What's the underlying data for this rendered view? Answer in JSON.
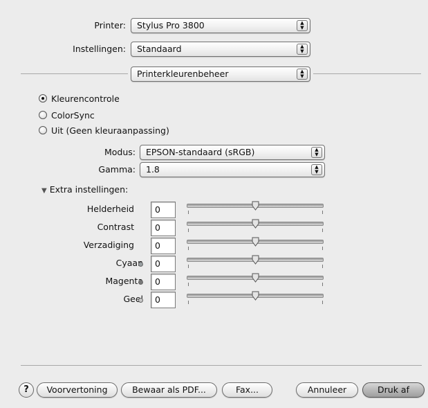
{
  "printer": {
    "label": "Printer:",
    "value": "Stylus Pro 3800"
  },
  "presets": {
    "label": "Instellingen:",
    "value": "Standaard"
  },
  "panel": {
    "value": "Printerkleurenbeheer"
  },
  "color_management": {
    "options": [
      "Kleurencontrole",
      "ColorSync",
      "Uit (Geen kleuraanpassing)"
    ],
    "selected_index": 0
  },
  "mode": {
    "label": "Modus:",
    "value": "EPSON-standaard (sRGB)"
  },
  "gamma": {
    "label": "Gamma:",
    "value": "1.8"
  },
  "extra": {
    "label": "Extra instellingen:",
    "expanded": true,
    "sliders": [
      {
        "label": "Helderheid",
        "value": "0",
        "level": 0.5,
        "dot": null
      },
      {
        "label": "Contrast",
        "value": "0",
        "level": 0.5,
        "dot": null
      },
      {
        "label": "Verzadiging",
        "value": "0",
        "level": 0.5,
        "dot": null
      },
      {
        "label": "Cyaan",
        "value": "0",
        "level": 0.5,
        "dot": "#9aa0a3"
      },
      {
        "label": "Magenta",
        "value": "0",
        "level": 0.5,
        "dot": "#7a7a7a"
      },
      {
        "label": "Geel",
        "value": "0",
        "level": 0.5,
        "dot": "#c8c8c8"
      }
    ]
  },
  "footer": {
    "help": "?",
    "preview": "Voorvertoning",
    "save_pdf": "Bewaar als PDF...",
    "fax": "Fax...",
    "cancel": "Annuleer",
    "print": "Druk af"
  }
}
